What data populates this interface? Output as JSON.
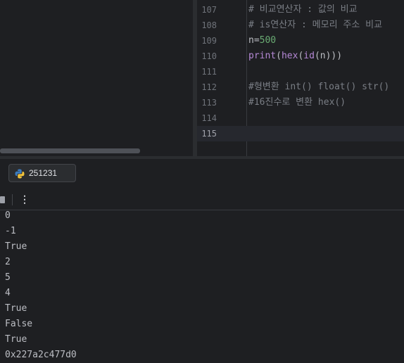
{
  "editor": {
    "lines": [
      {
        "number": "107",
        "tokens": [
          {
            "t": "# 비교연산자 : 값의 비교",
            "c": "cm"
          }
        ]
      },
      {
        "number": "108",
        "tokens": [
          {
            "t": "# is연산자 : 메모리 주소 비교",
            "c": "cm"
          }
        ]
      },
      {
        "number": "109",
        "tokens": [
          {
            "t": "n",
            "c": "tok-plain"
          },
          {
            "t": "=",
            "c": "tok-plain"
          },
          {
            "t": "500",
            "c": "num"
          }
        ]
      },
      {
        "number": "110",
        "tokens": [
          {
            "t": "print",
            "c": "kw"
          },
          {
            "t": "(",
            "c": "tok-plain"
          },
          {
            "t": "hex",
            "c": "kw"
          },
          {
            "t": "(",
            "c": "tok-plain"
          },
          {
            "t": "id",
            "c": "kw"
          },
          {
            "t": "(n)))",
            "c": "tok-plain"
          }
        ]
      },
      {
        "number": "111",
        "tokens": []
      },
      {
        "number": "112",
        "tokens": [
          {
            "t": "#형변환 int() float() str()",
            "c": "cm"
          }
        ]
      },
      {
        "number": "113",
        "tokens": [
          {
            "t": "#16진수로 변환 hex()",
            "c": "cm"
          }
        ]
      },
      {
        "number": "114",
        "tokens": []
      },
      {
        "number": "115",
        "tokens": [],
        "current": true
      }
    ]
  },
  "run_panel": {
    "tab_label": "251231",
    "tab_icon": "python-icon",
    "toolbar": {
      "stop_icon": "stop-icon",
      "more_icon": "more-vertical-icon"
    },
    "output": [
      "0",
      "-1",
      "True",
      "2",
      "5",
      "4",
      "True",
      "False",
      "True",
      "0x227a2c477d0"
    ]
  }
}
